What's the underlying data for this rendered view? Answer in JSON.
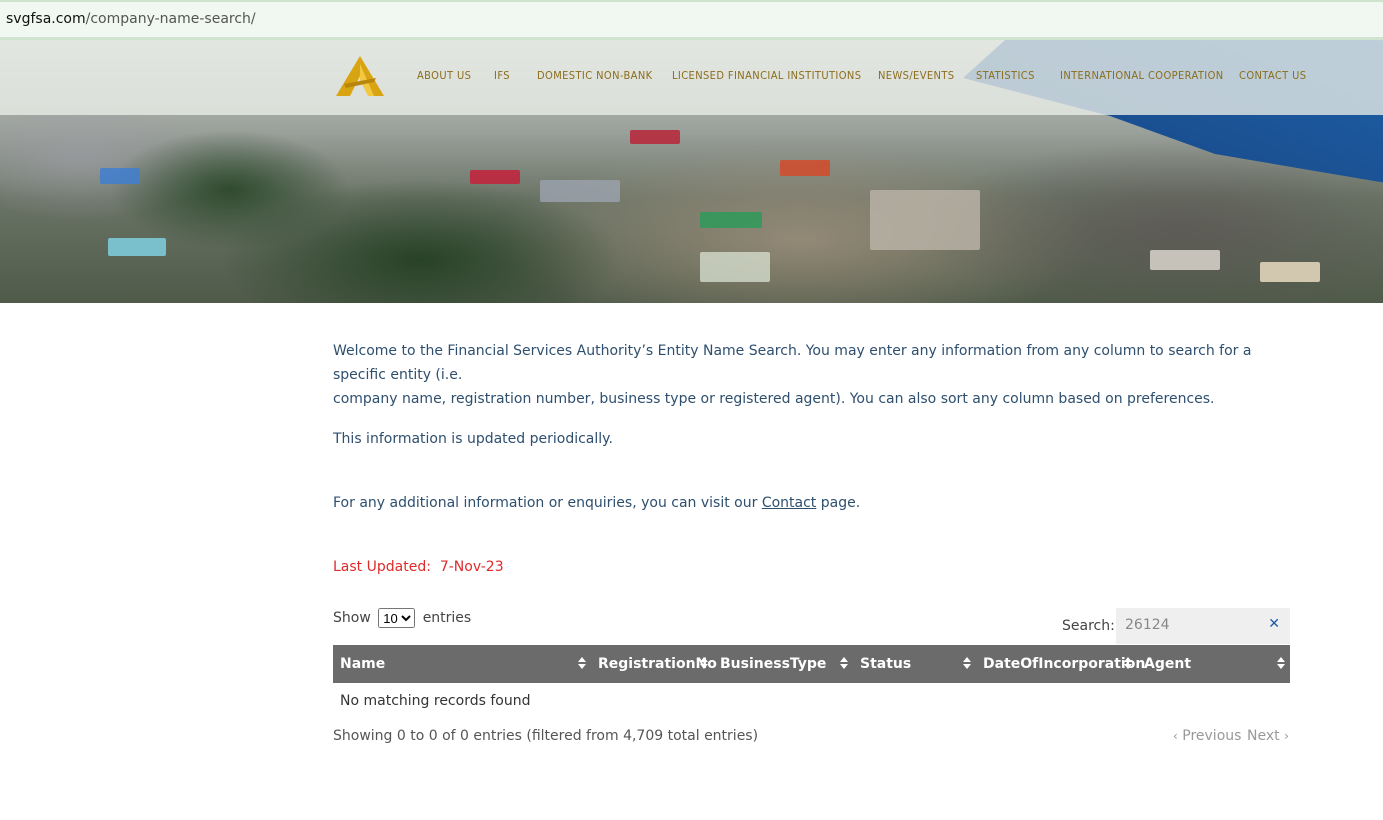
{
  "browser": {
    "url_host": "svgfsa.com",
    "url_path": "/company-name-search/"
  },
  "nav": {
    "items": [
      "ABOUT US",
      "IFS",
      "DOMESTIC NON-BANK",
      "LICENSED FINANCIAL INSTITUTIONS",
      "NEWS/EVENTS",
      "STATISTICS",
      "INTERNATIONAL COOPERATION",
      "CONTACT US"
    ],
    "accent_color": "#8a6d1c"
  },
  "intro": {
    "line1": "Welcome to the Financial Services Authority’s Entity Name Search. You may enter any information from any column to search for a specific entity (i.e.",
    "line2": "company name, registration number, business type or registered agent). You can also sort any column based on preferences.",
    "periodic": "This information is updated periodically.",
    "enquiry_prefix": "For any additional information or enquiries, you can visit our ",
    "contact_link": "Contact",
    "enquiry_suffix": " page.",
    "last_updated_label": "Last Updated:",
    "last_updated_value": "7-Nov-23"
  },
  "table_controls": {
    "show_label": "Show",
    "page_size": "10",
    "entries_label": "entries",
    "search_label": "Search:",
    "search_value": "26124",
    "clear_icon": "close-icon"
  },
  "table": {
    "columns": [
      "Name",
      "RegistrationNo",
      "BusinessType",
      "Status",
      "DateOfIncorporation",
      "Agent"
    ],
    "empty_message": "No matching records found",
    "info": "Showing 0 to 0 of 0 entries (filtered from 4,709 total entries)",
    "prev": "Previous",
    "next": "Next"
  }
}
